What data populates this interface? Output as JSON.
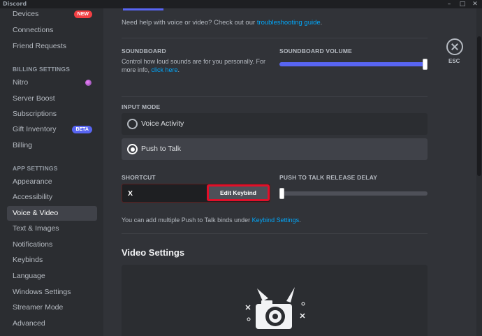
{
  "window": {
    "title": "Discord",
    "controls": [
      "–",
      "□",
      "✕"
    ]
  },
  "sidebar": {
    "items_top": [
      {
        "label": "Devices",
        "badge": "NEW"
      },
      {
        "label": "Connections"
      },
      {
        "label": "Friend Requests"
      }
    ],
    "billing_header": "BILLING SETTINGS",
    "billing_items": [
      {
        "label": "Nitro"
      },
      {
        "label": "Server Boost"
      },
      {
        "label": "Subscriptions"
      },
      {
        "label": "Gift Inventory",
        "badge": "BETA"
      },
      {
        "label": "Billing"
      }
    ],
    "app_header": "APP SETTINGS",
    "app_items": [
      {
        "label": "Appearance"
      },
      {
        "label": "Accessibility"
      },
      {
        "label": "Voice & Video",
        "active": true
      },
      {
        "label": "Text & Images"
      },
      {
        "label": "Notifications"
      },
      {
        "label": "Keybinds"
      },
      {
        "label": "Language"
      },
      {
        "label": "Windows Settings"
      },
      {
        "label": "Streamer Mode"
      },
      {
        "label": "Advanced"
      }
    ]
  },
  "main": {
    "help_text": "Need help with voice or video? Check out our ",
    "help_link": "troubleshooting guide",
    "help_end": ".",
    "soundboard": {
      "label": "SOUNDBOARD",
      "desc": "Control how loud sounds are for you personally. For more info, ",
      "desc_link": "click here",
      "desc_end": ".",
      "volume_label": "SOUNDBOARD VOLUME",
      "volume_level": 1.0
    },
    "input_mode": {
      "label": "INPUT MODE",
      "options": [
        {
          "label": "Voice Activity",
          "selected": false
        },
        {
          "label": "Push to Talk",
          "selected": true
        }
      ]
    },
    "shortcut": {
      "label": "SHORTCUT",
      "value": "X",
      "edit_button": "Edit Keybind"
    },
    "release_delay": {
      "label": "PUSH TO TALK RELEASE DELAY",
      "level": 0.0
    },
    "keybind_note": "You can add multiple Push to Talk binds under ",
    "keybind_link": "Keybind Settings",
    "keybind_end": ".",
    "video_title": "Video Settings"
  },
  "close": {
    "label": "ESC"
  },
  "colors": {
    "accent": "#5865f2",
    "link": "#00a8fc",
    "danger": "#e0102a"
  }
}
